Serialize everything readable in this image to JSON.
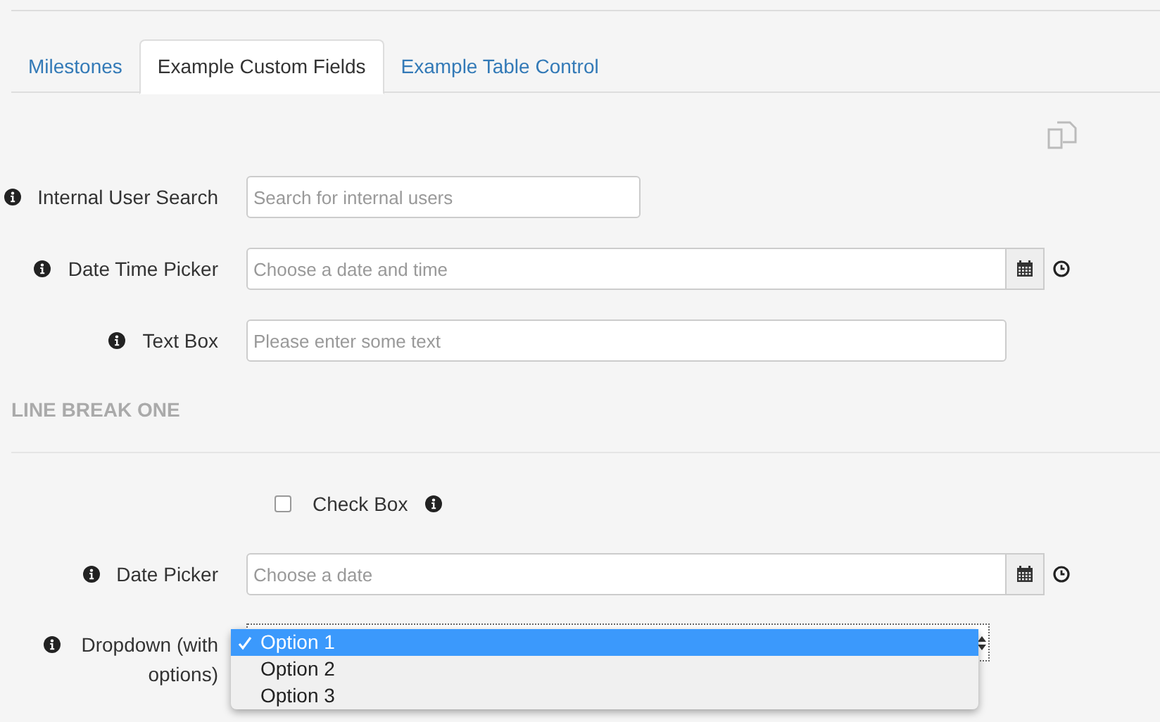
{
  "tabs": [
    {
      "label": "Milestones",
      "selected": false
    },
    {
      "label": "Example Custom Fields",
      "selected": true
    },
    {
      "label": "Example Table Control",
      "selected": false
    }
  ],
  "fields": [
    {
      "kind": "search",
      "label": "Internal User Search",
      "placeholder": "Search for internal users"
    },
    {
      "kind": "datetime",
      "label": "Date Time Picker",
      "placeholder": "Choose a date and time"
    },
    {
      "kind": "text",
      "label": "Text Box",
      "placeholder": "Please enter some text"
    }
  ],
  "section_heading": "LINE BREAK ONE",
  "section_fields": [
    {
      "kind": "checkbox",
      "label": "Check Box",
      "checked": false
    },
    {
      "kind": "date",
      "label": "Date Picker",
      "placeholder": "Choose a date"
    },
    {
      "kind": "dropdown",
      "label": "Dropdown (with options)",
      "options": [
        {
          "label": "Option 1",
          "selected": true
        },
        {
          "label": "Option 2",
          "selected": false
        },
        {
          "label": "Option 3",
          "selected": false
        }
      ]
    }
  ]
}
